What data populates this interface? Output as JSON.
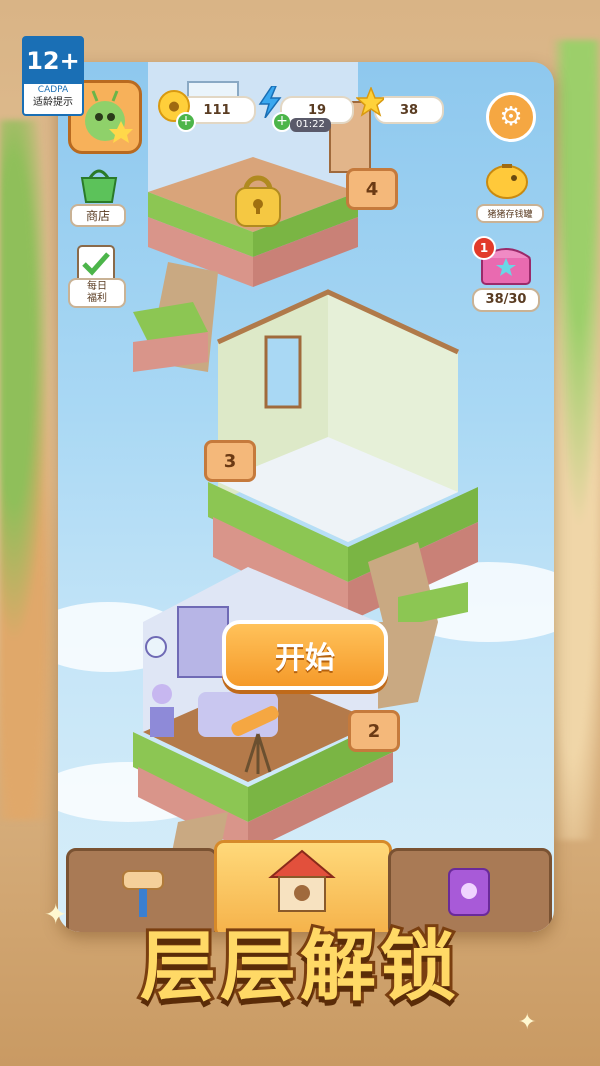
{
  "age_rating": {
    "rating": "12+",
    "org": "CADPA",
    "tip": "适龄提示"
  },
  "resources": {
    "coins": "111",
    "energy": "19",
    "energy_timer": "01:22",
    "stars": "38"
  },
  "side_menu": {
    "shop_label": "商店",
    "daily_label_1": "每日",
    "daily_label_2": "福利",
    "piggy_bank_label": "猪猪存钱罐",
    "chest_badge": "1",
    "chest_progress": "38/30"
  },
  "floors": [
    {
      "number": "4",
      "state": "locked"
    },
    {
      "number": "3",
      "state": "empty"
    },
    {
      "number": "2",
      "state": "furnished"
    }
  ],
  "start_button": "开始",
  "headline": "层层解锁",
  "colors": {
    "accent_orange": "#f59a2a",
    "sky": "#a9d8f4",
    "grass": "#8cc653",
    "brick": "#d9958a"
  }
}
